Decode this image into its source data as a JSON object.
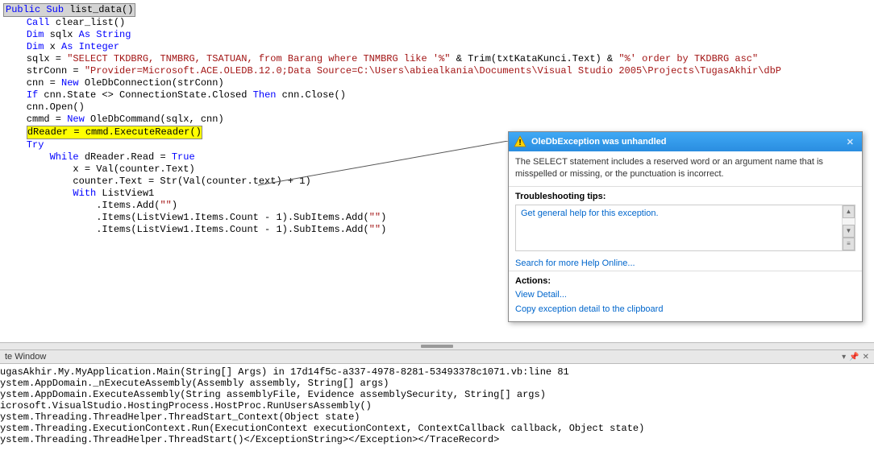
{
  "code": {
    "l1_pre": "",
    "l1_box_pub": "Public",
    "l1_box_sub": " Sub",
    "l1_box_name": " list_data()",
    "l2_pre": "    ",
    "l2_kw": "Call",
    "l2_rest": " clear_list()",
    "l3": "",
    "l4_pre": "    ",
    "l4_kw1": "Dim",
    "l4_mid": " sqlx ",
    "l4_kw2": "As String",
    "l5_pre": "    ",
    "l5_kw1": "Dim",
    "l5_mid": " x ",
    "l5_kw2": "As Integer",
    "l6": "",
    "l7_pre": "    sqlx = ",
    "l7_str": "\"SELECT TKDBRG, TNMBRG, TSATUAN, from Barang where TNMBRG like '%\"",
    "l7_mid": " & Trim(txtKataKunci.Text) & ",
    "l7_str2": "\"%' order by TKDBRG asc\"",
    "l8": "",
    "l9_pre": "    strConn = ",
    "l9_str": "\"Provider=Microsoft.ACE.OLEDB.12.0;Data Source=C:\\Users\\abiealkania\\Documents\\Visual Studio 2005\\Projects\\TugasAkhir\\dbP",
    "l10_pre": "    cnn = ",
    "l10_kw": "New",
    "l10_rest": " OleDbConnection(strConn)",
    "l11_pre": "    ",
    "l11_kw1": "If",
    "l11_mid": " cnn.State <> ConnectionState.Closed ",
    "l11_kw2": "Then",
    "l11_rest": " cnn.Close()",
    "l12": "    cnn.Open()",
    "l13": "",
    "l14_pre": "    cmmd = ",
    "l14_kw": "New",
    "l14_rest": " OleDbCommand(sqlx, cnn)",
    "l15_pre": "    ",
    "l15_hl": "dReader = cmmd.ExecuteReader()",
    "l16": "",
    "l17_pre": "    ",
    "l17_kw": "Try",
    "l18_pre": "        ",
    "l18_kw1": "While",
    "l18_mid": " dReader.Read = ",
    "l18_kw2": "True",
    "l19": "            x = Val(counter.Text)",
    "l20": "            counter.Text = Str(Val(counter.text) + 1)",
    "l21": "",
    "l22_pre": "            ",
    "l22_kw": "With",
    "l22_rest": " ListView1",
    "l23_pre": "                .Items.Add(",
    "l23_str": "\"\"",
    "l23_post": ")",
    "l24_pre": "                .Items(ListView1.Items.Count - 1).SubItems.Add(",
    "l24_str": "\"\"",
    "l24_post": ")",
    "l25_pre": "                .Items(ListView1.Items.Count - 1).SubItems.Add(",
    "l25_str": "\"\"",
    "l25_post": ")"
  },
  "exception": {
    "title": "OleDbException was unhandled",
    "message": "The SELECT statement includes a reserved word or an argument name that is misspelled or missing, or the punctuation is incorrect.",
    "tips_title": "Troubleshooting tips:",
    "tip1": "Get general help for this exception.",
    "search_online": "Search for more Help Online...",
    "actions_title": "Actions:",
    "view_detail": "View Detail...",
    "copy_detail": "Copy exception detail to the clipboard"
  },
  "panel": {
    "title": "te Window",
    "trace1": "ugasAkhir.My.MyApplication.Main(String[] Args) in 17d14f5c-a337-4978-8281-53493378c1071.vb:line 81",
    "trace2": "ystem.AppDomain._nExecuteAssembly(Assembly assembly, String[] args)",
    "trace3": "ystem.AppDomain.ExecuteAssembly(String assemblyFile, Evidence assemblySecurity, String[] args)",
    "trace4": "icrosoft.VisualStudio.HostingProcess.HostProc.RunUsersAssembly()",
    "trace5": "ystem.Threading.ThreadHelper.ThreadStart_Context(Object state)",
    "trace6": "ystem.Threading.ExecutionContext.Run(ExecutionContext executionContext, ContextCallback callback, Object state)",
    "trace7": "ystem.Threading.ThreadHelper.ThreadStart()</ExceptionString></Exception></TraceRecord>"
  }
}
